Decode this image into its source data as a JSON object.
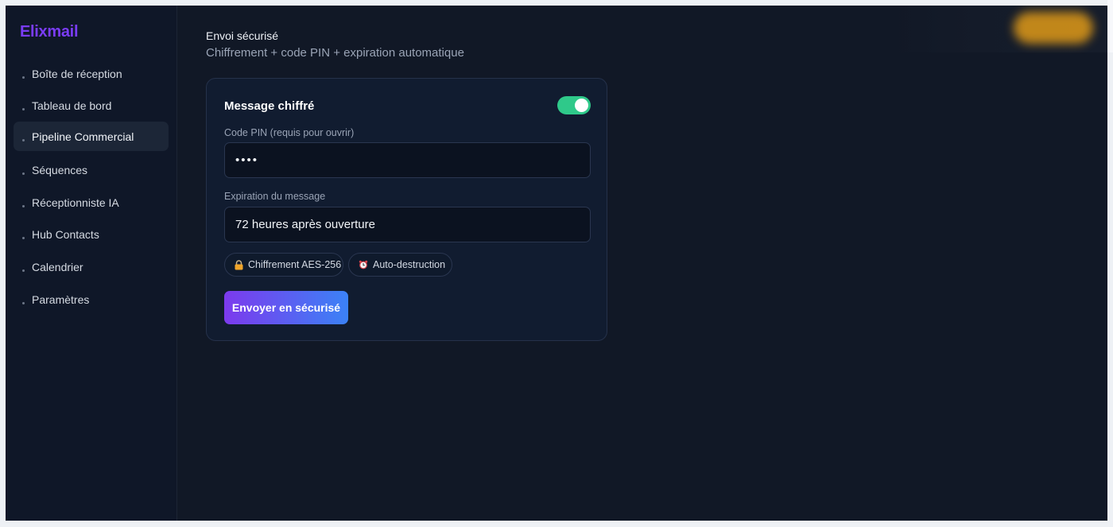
{
  "app": {
    "name": "Elixmail"
  },
  "sidebar": {
    "items": [
      {
        "label": "Boîte de réception",
        "active": false
      },
      {
        "label": "Tableau de bord",
        "active": false
      },
      {
        "label": "Pipeline Commercial",
        "active": true
      },
      {
        "label": "Séquences",
        "active": false
      },
      {
        "label": "Réceptionniste IA",
        "active": false
      },
      {
        "label": "Hub Contacts",
        "active": false
      },
      {
        "label": "Calendrier",
        "active": false
      },
      {
        "label": "Paramètres",
        "active": false
      }
    ]
  },
  "main": {
    "title": "Envoi sécurisé",
    "subtitle": "Chiffrement + code PIN + expiration automatique",
    "card": {
      "title": "Message chiffré",
      "toggle_on": true,
      "pin_label": "Code PIN (requis pour ouvrir)",
      "pin_value": "••••",
      "expiration_label": "Expiration du message",
      "expiration_value": "72 heures après ouverture",
      "chips": [
        {
          "icon": "lock-icon",
          "label": "Chiffrement AES-256"
        },
        {
          "icon": "alarm-clock-icon",
          "label": "Auto-destruction"
        }
      ],
      "send_label": "Envoyer en sécurisé"
    }
  },
  "colors": {
    "accent_purple": "#7c3aed",
    "accent_blue": "#3b82f6",
    "toggle_green": "#2fc98a",
    "background": "#111826",
    "sidebar_bg": "#0f1728"
  }
}
